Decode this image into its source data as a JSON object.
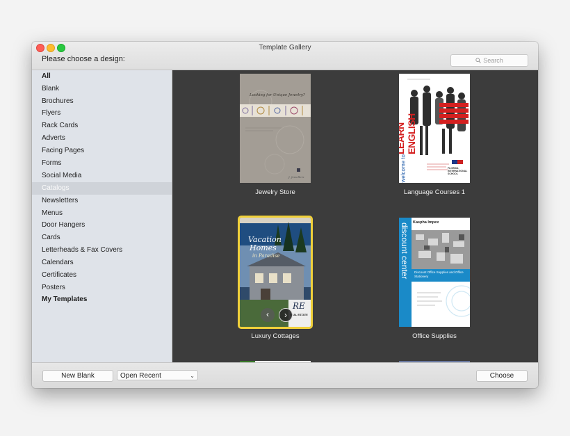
{
  "window": {
    "title": "Template Gallery",
    "prompt": "Please choose a design:",
    "search_placeholder": "Search"
  },
  "sidebar": {
    "items": [
      {
        "label": "All",
        "bold": true
      },
      {
        "label": "Blank"
      },
      {
        "label": "Brochures"
      },
      {
        "label": "Flyers"
      },
      {
        "label": "Rack Cards"
      },
      {
        "label": "Adverts"
      },
      {
        "label": "Facing Pages"
      },
      {
        "label": "Forms"
      },
      {
        "label": "Social Media"
      },
      {
        "label": "Catalogs",
        "selected": true
      },
      {
        "label": "Newsletters"
      },
      {
        "label": "Menus"
      },
      {
        "label": "Door Hangers"
      },
      {
        "label": "Cards"
      },
      {
        "label": "Letterheads & Fax Covers"
      },
      {
        "label": "Calendars"
      },
      {
        "label": "Certificates"
      },
      {
        "label": "Posters"
      },
      {
        "label": "My Templates",
        "bold": true
      }
    ]
  },
  "gallery": {
    "templates": [
      {
        "name": "Jewelry Store",
        "cover_text": "Looking for Unique Jewelry?",
        "signature": "J. Jewellers"
      },
      {
        "name": "Language Courses 1",
        "cover_text": "LEARN ENGLISH",
        "side_text": "welcome to",
        "school": "FLORIDA INTERNATIONAL SCHOOL"
      },
      {
        "name": "Luxury Cottages",
        "cover_title_1": "Vacation",
        "cover_title_2": "Homes",
        "cover_sub": "in Paradise",
        "logo": "RE",
        "logo_sub": "REAL ESTATE",
        "selected": true
      },
      {
        "name": "Office Supplies",
        "brand": "Kaspha Impex",
        "vertical_text": "discount center",
        "banner": "Discount Office Supplies and Office Stationery"
      }
    ]
  },
  "footer": {
    "new_blank": "New Blank",
    "open_recent": "Open Recent",
    "choose": "Choose"
  },
  "colors": {
    "gallery_bg": "#3c3c3c",
    "sidebar_bg": "#dfe3e9",
    "selection_outline": "#f0d03a",
    "close": "#fe5f57",
    "minimize": "#febc2e",
    "maximize": "#28c840"
  }
}
